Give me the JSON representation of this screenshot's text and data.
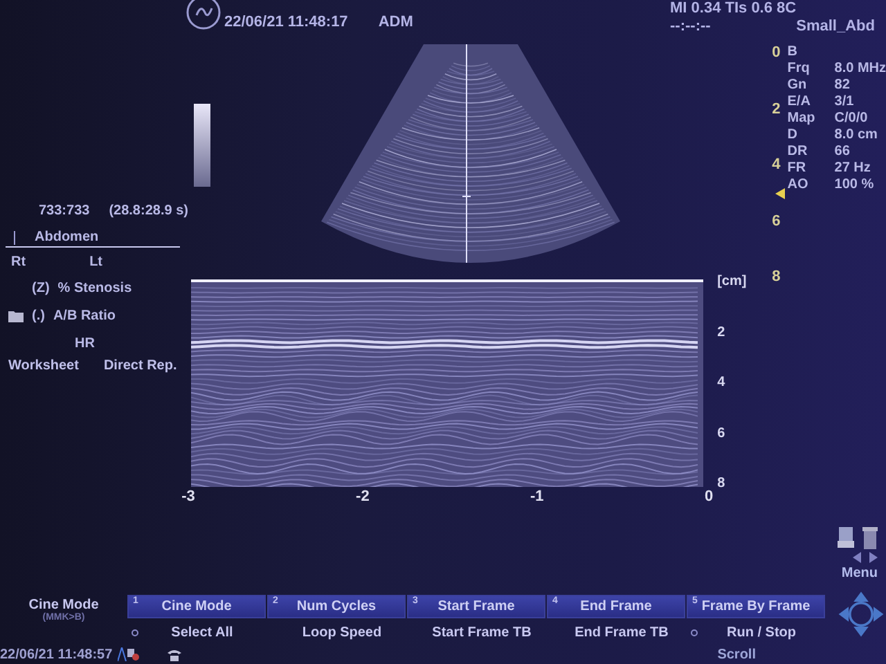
{
  "header": {
    "date_time": "22/06/21 11:48:17",
    "operator": "ADM",
    "indices": "MI 0.34 TIs 0.6 8C",
    "timer": "--:--:--",
    "preset": "Small_Abd"
  },
  "cine": {
    "frames": "733:733",
    "time": "(28.8:28.9 s)"
  },
  "worksheet": {
    "category": "Abdomen",
    "sides": [
      "Rt",
      "Lt"
    ],
    "measurements": [
      {
        "key": "(Z)",
        "label": "% Stenosis",
        "folder": false
      },
      {
        "key": "(.)",
        "label": "A/B Ratio",
        "folder": true
      },
      {
        "label": "HR",
        "folder": false
      }
    ],
    "tabs": [
      "Worksheet",
      "Direct Rep."
    ]
  },
  "mmode": {
    "depth_unit": "[cm]",
    "depth_ticks": [
      "2",
      "4",
      "6",
      "8"
    ],
    "time_ticks": [
      "-3",
      "-2",
      "-1",
      "0"
    ]
  },
  "scale": {
    "ticks": [
      "0",
      "2",
      "4",
      "6",
      "8"
    ]
  },
  "params": {
    "mode": "B",
    "rows": [
      {
        "name": "Frq",
        "value": "8.0 MHz"
      },
      {
        "name": "Gn",
        "value": "82"
      },
      {
        "name": "E/A",
        "value": "3/1"
      },
      {
        "name": "Map",
        "value": "C/0/0"
      },
      {
        "name": "D",
        "value": "8.0 cm"
      },
      {
        "name": "DR",
        "value": "66"
      },
      {
        "name": "FR",
        "value": "27 Hz"
      },
      {
        "name": "AO",
        "value": "100 %"
      }
    ]
  },
  "softkeys": {
    "mode_label": "Cine Mode",
    "mode_hint": "(MMK>B)",
    "top": [
      {
        "number": "1",
        "label": "Cine Mode"
      },
      {
        "number": "2",
        "label": "Num Cycles"
      },
      {
        "number": "3",
        "label": "Start Frame"
      },
      {
        "number": "4",
        "label": "End Frame"
      },
      {
        "number": "5",
        "label": "Frame By Frame"
      }
    ],
    "bottom": [
      {
        "label": "Select All",
        "knob": true
      },
      {
        "label": "Loop Speed",
        "knob": false
      },
      {
        "label": "Start Frame TB",
        "knob": false
      },
      {
        "label": "End Frame TB",
        "knob": false
      },
      {
        "label": "Run / Stop",
        "knob": true
      }
    ],
    "scroll": "Scroll",
    "menu": "Menu"
  },
  "status": {
    "date_time": "22/06/21 11:48:57"
  }
}
